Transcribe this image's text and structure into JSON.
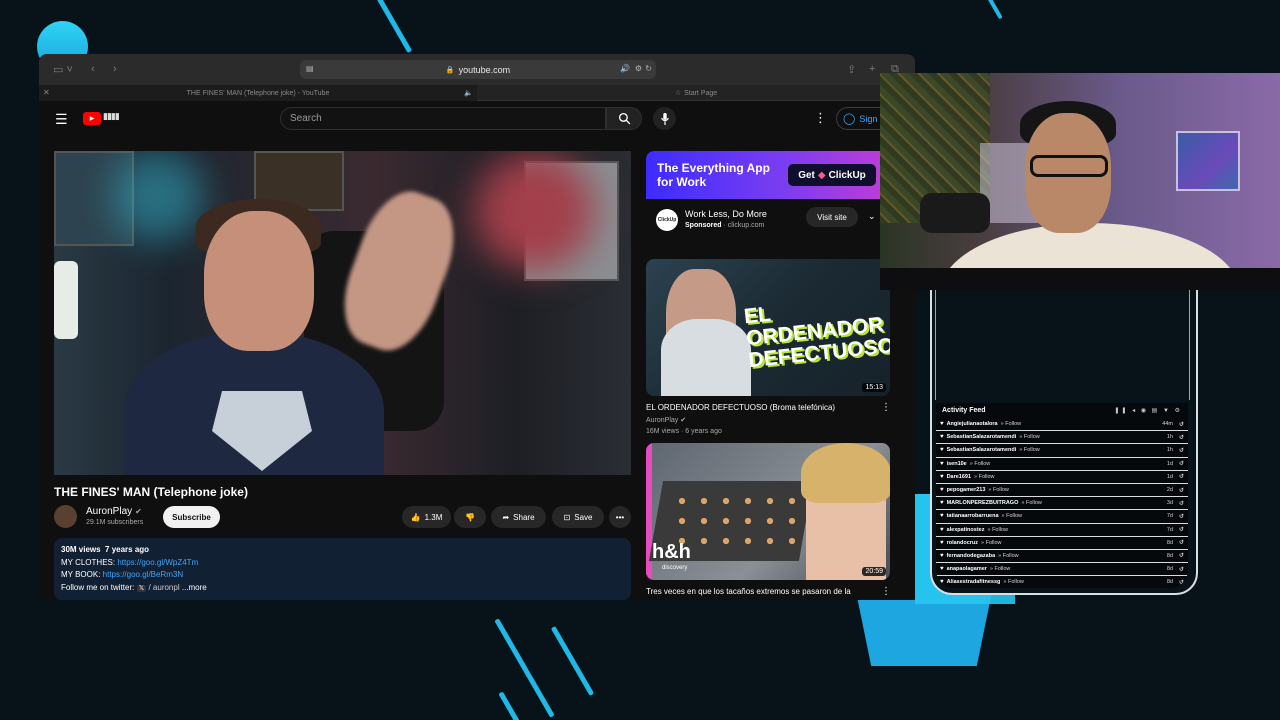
{
  "browser": {
    "url": "youtube.com",
    "tabs": [
      "THE FINES' MAN (Telephone joke) - YouTube",
      "Start Page"
    ]
  },
  "youtube": {
    "search_placeholder": "Search",
    "sign_in": "Sign",
    "video": {
      "title": "THE FINES' MAN (Telephone joke)",
      "channel": "AuronPlay",
      "subscribers": "29.1M subscribers",
      "subscribe": "Subscribe",
      "likes": "1.3M",
      "share": "Share",
      "save": "Save"
    },
    "description": {
      "views": "30M views",
      "age": "7 years ago",
      "line1_label": "MY CLOTHES: ",
      "line1_link": "https://goo.gl/WpZ4Tm",
      "line2_label": "MY BOOK: ",
      "line2_link": "https://goo.gl/BeRm3N",
      "line3": "Follow me on twitter:",
      "line3_handle": "/ auronpl",
      "more": "...more"
    },
    "ad": {
      "headline": "The Everything App for Work",
      "cta": "Get",
      "brand": "ClickUp",
      "title": "Work Less, Do More",
      "sponsored": "Sponsored",
      "domain": "clickup.com",
      "visit": "Visit site"
    },
    "related": [
      {
        "title": "EL ORDENADOR DEFECTUOSO (Broma telefónica)",
        "channel": "AuronPlay",
        "meta": "16M views · 6 years ago",
        "duration": "15:13",
        "thumb_text": "EL ORDENADOR DEFECTUOSO"
      },
      {
        "title": "Tres veces en que los tacaños extremos se pasaron de la",
        "duration": "20:59",
        "thumb_text": "h&h",
        "thumb_sub": "discovery"
      }
    ]
  },
  "activity_feed": {
    "title": "Activity Feed",
    "items": [
      {
        "user": "Angiejulianaotalora",
        "action": "Follow",
        "time": "44m"
      },
      {
        "user": "SebastianSalazarotamendi",
        "action": "Follow",
        "time": "1h"
      },
      {
        "user": "SebastianSalazarotamendi",
        "action": "Follow",
        "time": "1h"
      },
      {
        "user": "isen10e",
        "action": "Follow",
        "time": "1d"
      },
      {
        "user": "Dare1691",
        "action": "Follow",
        "time": "1d"
      },
      {
        "user": "pepogamer213",
        "action": "Follow",
        "time": "2d"
      },
      {
        "user": "MARLONPEREZBUITRAGO",
        "action": "Follow",
        "time": "3d"
      },
      {
        "user": "tatianaarrobarruena",
        "action": "Follow",
        "time": "7d"
      },
      {
        "user": "alexpatinostez",
        "action": "Follow",
        "time": "7d"
      },
      {
        "user": "rolandocruz",
        "action": "Follow",
        "time": "8d"
      },
      {
        "user": "fernandodegazaba",
        "action": "Follow",
        "time": "8d"
      },
      {
        "user": "anapaolagamer",
        "action": "Follow",
        "time": "8d"
      },
      {
        "user": "Aliasestradafitnessg",
        "action": "Follow",
        "time": "8d"
      }
    ]
  },
  "colors": {
    "accent_cyan": "#1fb8e8",
    "youtube_red": "#ff0000",
    "link_blue": "#3ea6ff"
  }
}
